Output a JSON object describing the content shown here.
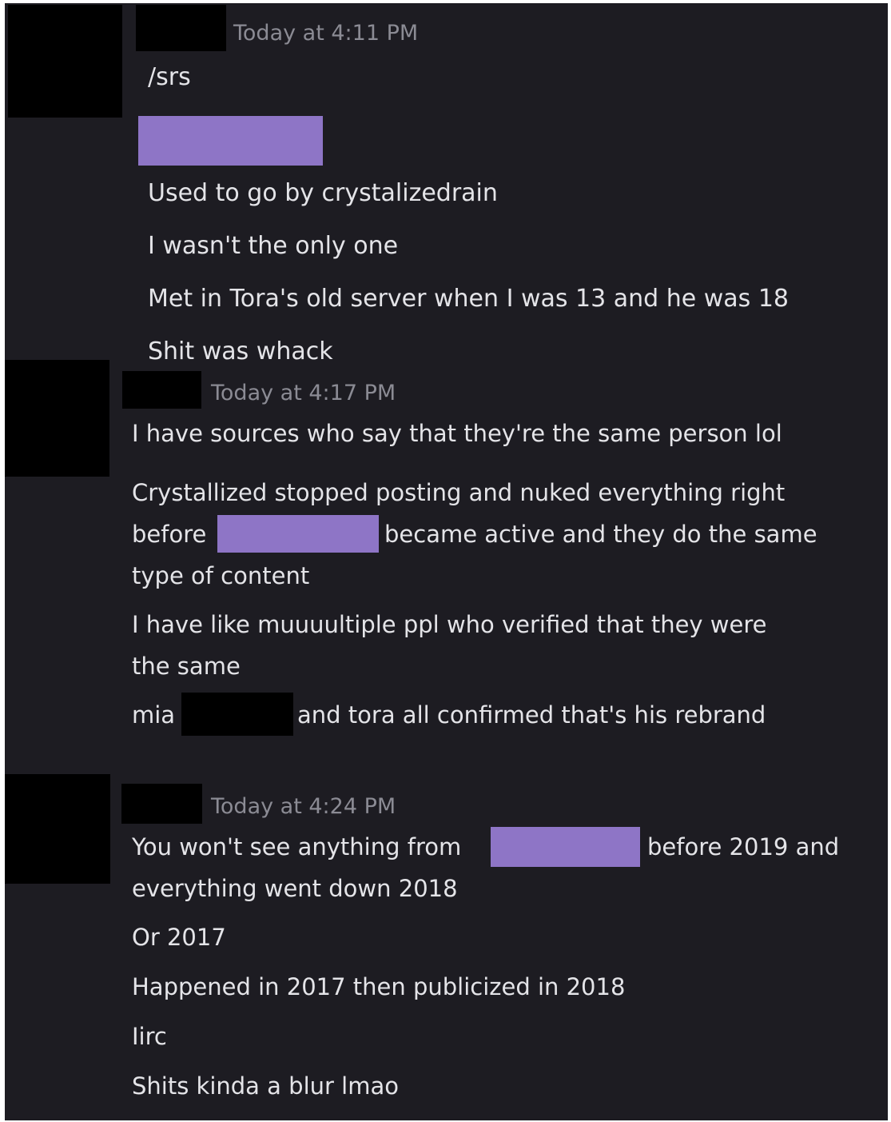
{
  "colors": {
    "background": "#1d1c22",
    "timestamp": "#8b8b94",
    "message_text": "#e4e4e8",
    "redaction_purple": "#8e75c6",
    "redaction_black": "#000000"
  },
  "messages": [
    {
      "timestamp": "Today at 4:11 PM",
      "lines": [
        "/srs",
        "Used to go by crystalizedrain",
        "I wasn't the only one",
        "Met in Tora's old server when I was 13 and he was 18",
        "Shit was whack"
      ]
    },
    {
      "timestamp": "Today at 4:17 PM",
      "lines": [
        "I have sources who say that they're the same person lol",
        "Crystallized stopped posting and nuked everything right",
        "before",
        "became active and they do the same",
        "type of content",
        "I have like muuuultiple ppl who verified that they were",
        "the same",
        "mia",
        "and tora all confirmed that's his rebrand"
      ]
    },
    {
      "timestamp": "Today at 4:24 PM",
      "lines": [
        "You won't see anything from",
        "before 2019 and",
        "everything went down 2018",
        "Or 2017",
        "Happened in 2017 then publicized in 2018",
        "Iirc",
        "Shits kinda a blur lmao"
      ]
    }
  ]
}
